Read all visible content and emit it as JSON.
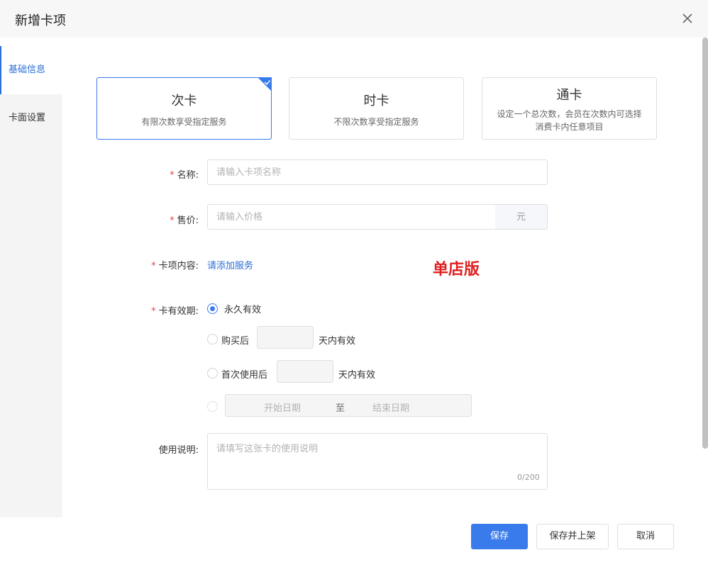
{
  "dialog": {
    "title": "新增卡项"
  },
  "sidebar": {
    "items": [
      {
        "label": "基础信息"
      },
      {
        "label": "卡面设置"
      }
    ]
  },
  "card_types": [
    {
      "name": "次卡",
      "desc": "有限次数享受指定服务",
      "selected": true
    },
    {
      "name": "时卡",
      "desc": "不限次数享受指定服务",
      "selected": false
    },
    {
      "name": "通卡",
      "desc": "设定一个总次数，会员在次数内可选择消费卡内任意项目",
      "selected": false
    }
  ],
  "form": {
    "name": {
      "label": "名称:",
      "placeholder": "请输入卡项名称"
    },
    "price": {
      "label": "售价:",
      "placeholder": "请输入价格",
      "unit": "元"
    },
    "content": {
      "label": "卡项内容:",
      "link": "请添加服务"
    },
    "edition_note": "单店版",
    "validity": {
      "label": "卡有效期:",
      "options": {
        "permanent": "永久有效",
        "after_purchase": "购买后",
        "after_first_use": "首次使用后",
        "within_days": "天内有效"
      },
      "date_start": "开始日期",
      "date_sep": "至",
      "date_end": "结束日期"
    },
    "instructions": {
      "label": "使用说明:",
      "placeholder": "请填写这张卡的使用说明",
      "counter": "0/200"
    }
  },
  "buttons": {
    "save": "保存",
    "save_publish": "保存并上架",
    "cancel": "取消"
  },
  "colors": {
    "accent": "#3a7bec",
    "required": "#e34545",
    "note": "#e02020"
  }
}
